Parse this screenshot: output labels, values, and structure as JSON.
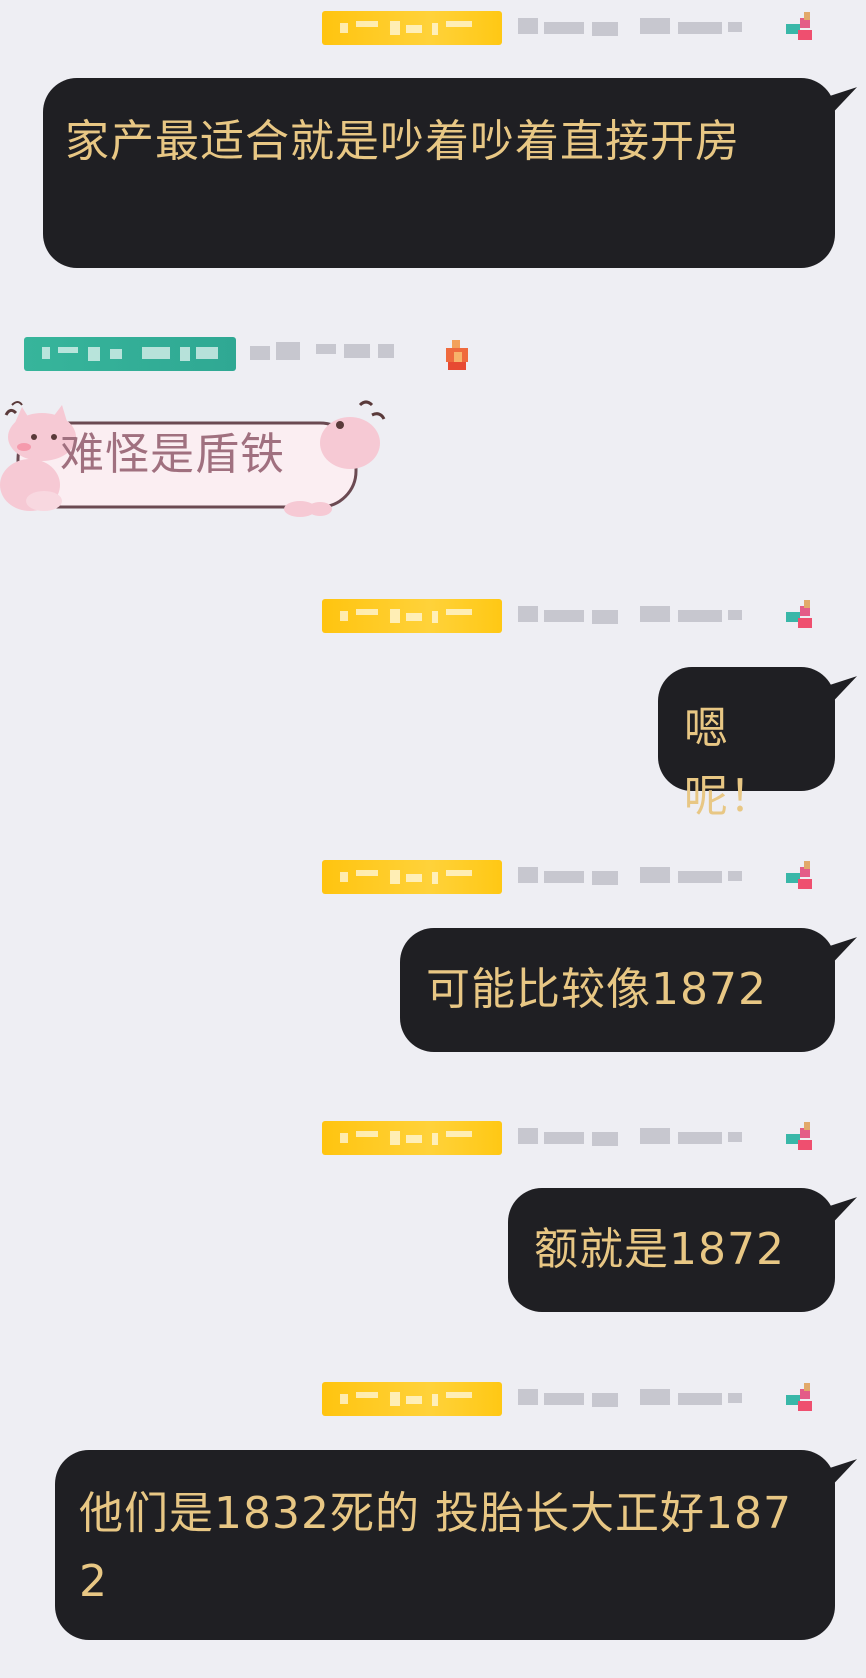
{
  "messages": [
    {
      "side": "right",
      "text": "家产最适合就是吵着吵着直接开房"
    },
    {
      "side": "left",
      "text": "难怪是盾铁"
    },
    {
      "side": "right",
      "text": "嗯呢！"
    },
    {
      "side": "right",
      "text": "可能比较像1872"
    },
    {
      "side": "right",
      "text": "额就是1872"
    },
    {
      "side": "right",
      "text": "他们是1832死的 投胎长大正好1872"
    }
  ],
  "colors": {
    "background": "#eeeef3",
    "bubble": "#1f1f23",
    "bubble_text": "#e8c784",
    "gold_tag": "#ffc40f",
    "teal_tag": "#37b59b",
    "cat_text": "#a0707f"
  }
}
